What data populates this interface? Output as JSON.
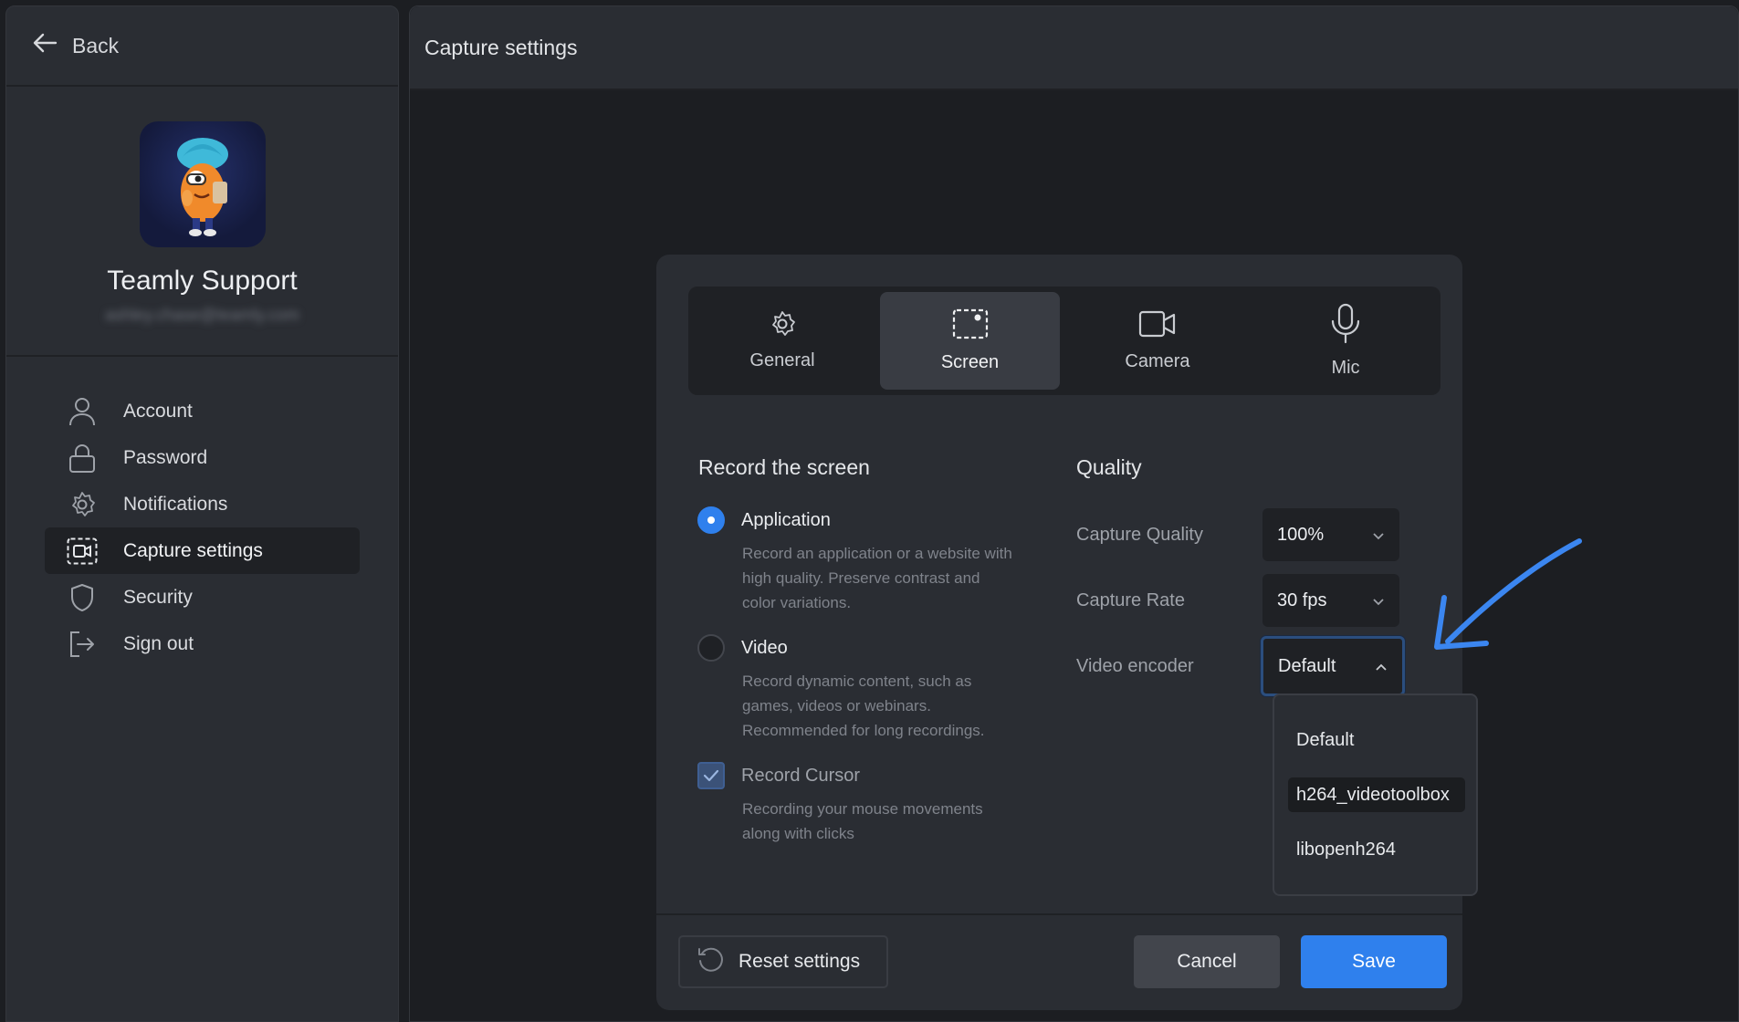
{
  "sidebar": {
    "back_label": "Back",
    "profile_name": "Teamly Support",
    "profile_email": "ashley.chase@teamly.com",
    "items": [
      {
        "label": "Account",
        "icon": "user-icon"
      },
      {
        "label": "Password",
        "icon": "lock-icon"
      },
      {
        "label": "Notifications",
        "icon": "gear-icon"
      },
      {
        "label": "Capture settings",
        "icon": "capture-icon",
        "active": true
      },
      {
        "label": "Security",
        "icon": "shield-icon"
      },
      {
        "label": "Sign out",
        "icon": "sign-out-icon"
      }
    ]
  },
  "header": {
    "title": "Capture settings"
  },
  "tabs": [
    {
      "label": "General",
      "icon": "gear-icon"
    },
    {
      "label": "Screen",
      "icon": "screen-capture-icon",
      "active": true
    },
    {
      "label": "Camera",
      "icon": "camera-icon"
    },
    {
      "label": "Mic",
      "icon": "mic-icon"
    }
  ],
  "record": {
    "title": "Record the screen",
    "application": {
      "label": "Application",
      "desc_lines": [
        "Record an application or a website with",
        "high quality. Preserve contrast and",
        "color variations."
      ],
      "selected": true
    },
    "video": {
      "label": "Video",
      "desc_lines": [
        "Record dynamic content, such as",
        "games, videos or webinars.",
        "Recommended for long recordings."
      ],
      "selected": false
    },
    "cursor": {
      "label": "Record Cursor",
      "desc_lines": [
        "Recording your mouse movements",
        "along with clicks"
      ],
      "checked": true
    }
  },
  "quality": {
    "title": "Quality",
    "capture_quality": {
      "label": "Capture Quality",
      "value": "100%"
    },
    "capture_rate": {
      "label": "Capture Rate",
      "value": "30 fps"
    },
    "video_encoder": {
      "label": "Video encoder",
      "value": "Default",
      "open": true
    }
  },
  "encoder_options": [
    "Default",
    "h264_videotoolbox",
    "libopenh264"
  ],
  "buttons": {
    "reset": "Reset settings",
    "cancel": "Cancel",
    "save": "Save"
  },
  "colors": {
    "accent": "#2f80ed",
    "arrow": "#3b86f0",
    "background": "#1c1e22",
    "panel": "#2a2d33"
  }
}
